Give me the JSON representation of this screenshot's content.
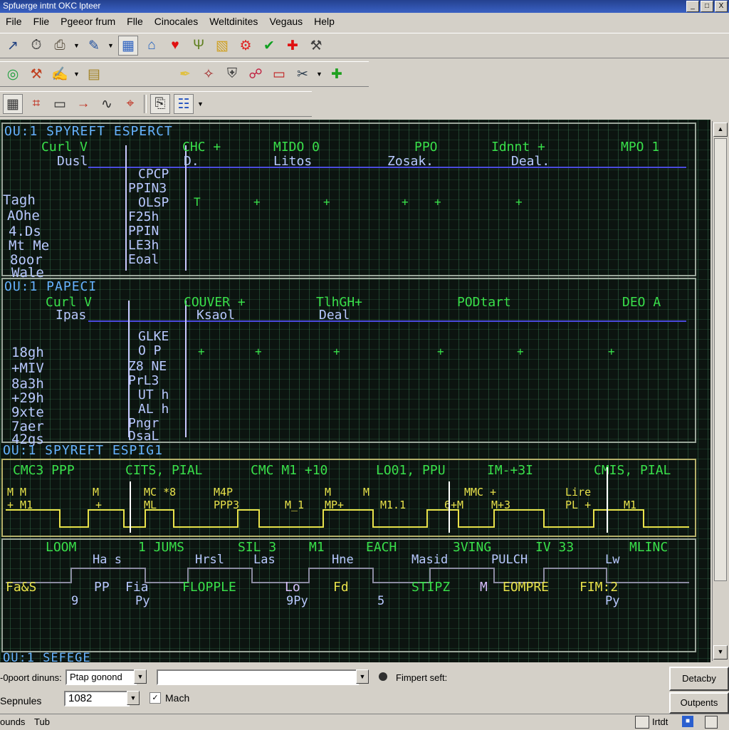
{
  "window": {
    "title": "Spfuerge intnt OKC lpteer",
    "controls": [
      "_",
      "□",
      "X"
    ]
  },
  "menu": [
    "File",
    "Flie",
    "Pgeeor frum",
    "Flle",
    "Cinocales",
    "Weltdinites",
    "Vegaus",
    "Help"
  ],
  "toolbar1_icons": [
    "chart-arrow-icon",
    "stopwatch-icon",
    "printer-icon",
    "pen-icon",
    "grid-chart-icon",
    "network-icon",
    "heart-icon",
    "antenna-icon",
    "palette-icon",
    "gear-icon",
    "checkmark-icon",
    "cross-icon",
    "tools-icon"
  ],
  "toolbar2_icons": [
    "globe-icon",
    "wrench-icon",
    "pencil-tool-icon",
    "blocks-icon",
    "pen-tip-icon",
    "magic-wand-icon",
    "shield-icon",
    "connector-icon",
    "monitor-icon",
    "scissors-icon",
    "plus-icon"
  ],
  "toolbar3_icons": [
    "calculator-icon",
    "signal-icon",
    "lcd-icon",
    "probe-icon",
    "waveform-icon",
    "cursor-icon",
    "clipboard-icon",
    "document-icon"
  ],
  "panel1": {
    "header": "OU:1 SPYREFT ESPERCT",
    "left_label": "Curl V",
    "left_sub": "Dusl",
    "col_headers": [
      "CHC +",
      "MIDO 0",
      "PPO",
      "Idnnt +",
      "MPO 1"
    ],
    "col_subs": [
      "D.",
      "Litos",
      "Zosak.",
      "Deal."
    ],
    "rows": [
      "Tagh",
      "AOhe",
      "4.Ds",
      "Mt Me",
      "8oor",
      "Wale"
    ],
    "pins": [
      "CPCP",
      "PPIN3",
      "OLSP",
      "F25h",
      "PPIN",
      "LE3h",
      "Eoal"
    ],
    "markers": [
      "T",
      "+",
      "+",
      "+",
      "+",
      "+"
    ]
  },
  "panel2": {
    "header": "OU:1 PAPECI",
    "left_label": "Curl V",
    "left_sub": "Ipas",
    "col_headers": [
      "COUVER +",
      "TlhGH+",
      "PODtart",
      "DEO A"
    ],
    "col_subs": [
      "Ksaol",
      "Deal"
    ],
    "rows": [
      "18gh",
      "+MIV",
      "8a3h",
      "+29h",
      "9xte",
      "7aer",
      "42gs"
    ],
    "pins": [
      "GLKE",
      "O P",
      "Z8 NE",
      "PrL3",
      "UT h",
      "AL h",
      "Pngr",
      "DsaL"
    ],
    "markers": [
      "+",
      "+",
      "+",
      "+",
      "+",
      "+"
    ]
  },
  "panel3": {
    "header": "OU:1 SPYREFT ESPIG1",
    "labels": [
      "CMC3 PPP",
      "CITS, PIAL",
      "CMC M1 +10",
      "LO01, PPU",
      "IM-+3I",
      "CMIS, PIAL"
    ],
    "signals": [
      "M M",
      "M",
      "MC *8",
      "M4P",
      "M",
      "M",
      "MMC +",
      "Lire"
    ],
    "signal_subs": [
      "+ M1",
      "+",
      "ML",
      "PPP3",
      "M_1",
      "MP+",
      "M1.1",
      "6+M",
      "M+3",
      "PL +",
      "M1"
    ]
  },
  "panel4": {
    "labels_top": [
      "LOOM",
      "1 JUMS",
      "SIL 3",
      "M1",
      "EACH",
      "3VING",
      "IV 33",
      "MLINC"
    ],
    "labels_mid": [
      "Ha s",
      "Hrsl",
      "Las",
      "Hne",
      "Masid",
      "PULCH",
      "Lw"
    ],
    "labels_bottom": [
      "Fa&S",
      "PP",
      "Fia",
      "FLOPPLE",
      "Lo",
      "Fd",
      "STIPZ",
      "M",
      "EOMPRE",
      "FIM:2"
    ],
    "subs": [
      "9",
      "Py",
      "9Py",
      "5",
      "Py"
    ],
    "footer": "OU:1 SEFEGE"
  },
  "controls": {
    "port_label": "-0poort dinuns:",
    "port_value": "Ptap gonond",
    "text_value": "",
    "radio_label": "Fimpert seft:",
    "sepules_label": "Sepnules",
    "sepules_value": "1082",
    "check_label": "Mach",
    "button1": "Detacby",
    "button2": "Outpents"
  },
  "status": {
    "left": "ounds",
    "tab": "Tub",
    "right": "Irtdt",
    "icons": [
      "disk-icon",
      "lock-icon",
      "save-icon"
    ]
  }
}
